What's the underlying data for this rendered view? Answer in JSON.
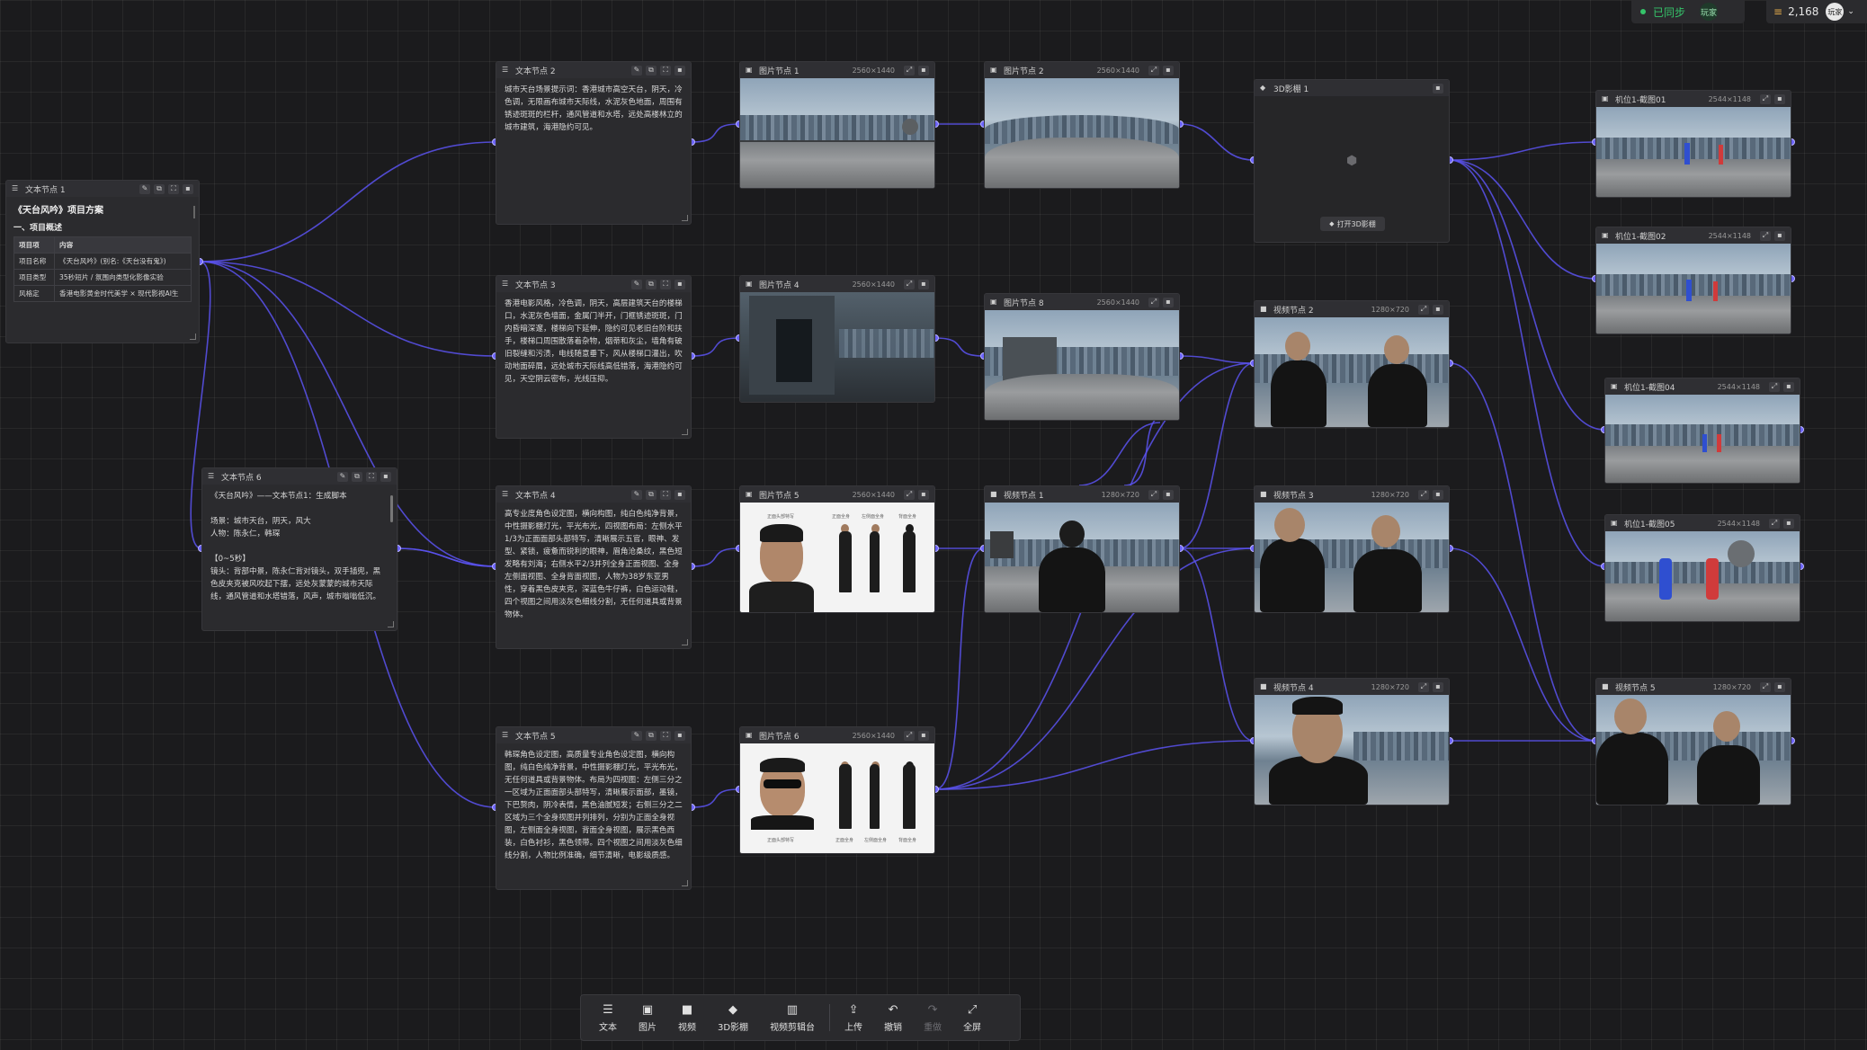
{
  "status": {
    "synced_label": "已同步",
    "user_tag": "玩家",
    "credits": "2,168",
    "avatar_label": "玩家"
  },
  "toolbar": {
    "text": "文本",
    "image": "图片",
    "video": "视频",
    "studio3d": "3D影棚",
    "video_editor": "视频剪辑台",
    "upload": "上传",
    "undo": "撤销",
    "redo": "重做",
    "fullscreen": "全屏"
  },
  "nodes": {
    "text1": {
      "title": "文本节点 1",
      "heading": "《天台风吟》项目方案",
      "section": "一、项目概述",
      "table_header": [
        "项目项",
        "内容"
      ],
      "rows": [
        [
          "项目名称",
          "《天台风吟》(别名:《天台没有鬼》)"
        ],
        [
          "项目类型",
          "35秒短片 / 氛围向类型化影像实验"
        ],
        [
          "风格定",
          "香港电影黄金时代美学 × 现代影视AI生"
        ]
      ]
    },
    "text2": {
      "title": "文本节点 2",
      "body": "城市天台场景提示词：香港城市高空天台，阴天，冷色调，无限画布城市天际线，水泥灰色地面，周围有锈迹斑斑的栏杆，通风管道和水塔，远处高楼林立的城市建筑，海港隐约可见。"
    },
    "text3": {
      "title": "文本节点 3",
      "body": "香港电影风格，冷色调，阴天，高层建筑天台的楼梯口，水泥灰色墙面，金属门半开，门框锈迹斑斑，门内昏暗深邃，楼梯向下延伸，隐约可见老旧台阶和扶手，楼梯口周围散落着杂物，烟蒂和灰尘，墙角有破旧裂缝和污渍，电线随意垂下，风从楼梯口灌出，吹动地面碎屑，远处城市天际线高低错落，海港隐约可见，天空阴云密布，光线压抑。"
    },
    "text4": {
      "title": "文本节点 4",
      "body": "高专业度角色设定图，横向构图，纯白色纯净背景，中性摄影棚灯光，平光布光，四视图布局：左侧水平1/3为正面面部头部特写，清晰展示五官，眼神、发型、紧锁，疲惫而锐利的眼神，眉角沧桑纹，黑色短发略有刘海；右侧水平2/3并列全身正面视图、全身左侧面视图、全身背面视图，人物为38岁东亚男性，穿着黑色皮夹克，深蓝色牛仔裤，白色运动鞋，四个视图之间用淡灰色细线分割，无任何道具或背景物体。"
    },
    "text5": {
      "title": "文本节点 5",
      "body": "韩琛角色设定图，高质量专业角色设定图，横向构图，纯白色纯净背景，中性摄影棚灯光，平光布光，无任何道具或背景物体。布局为四视图：左侧三分之一区域为正面面部头部特写，清晰展示面部，墨镜，下巴赘肉，阴冷表情，黑色油腻短发；右侧三分之二区域为三个全身视图并列排列，分别为正面全身视图，左侧面全身视图，背面全身视图，展示黑色西装，白色衬衫，黑色领带。四个视图之间用淡灰色细线分割，人物比例准确，细节清晰，电影级质感。"
    },
    "text6": {
      "title": "文本节点 6",
      "body": "《天台风吟》——文本节点1：生成脚本\n\n场景：城市天台，阴天，风大\n人物：陈永仁，韩琛\n\n【0~5秒】\n镜头：背部中景，陈永仁背对镜头，双手插兜，黑色皮夹克被风吹起下摆，远处灰蒙蒙的城市天际线，通风管道和水塔错落，风声，城市嗡嗡低沉。"
    },
    "img1": {
      "title": "图片节点 1",
      "res": "2560×1440"
    },
    "img2": {
      "title": "图片节点 2",
      "res": "2560×1440"
    },
    "img4": {
      "title": "图片节点 4",
      "res": "2560×1440"
    },
    "img8": {
      "title": "图片节点 8",
      "res": "2560×1440"
    },
    "img5": {
      "title": "图片节点 5",
      "res": "2560×1440",
      "labels": [
        "正面头部特写",
        "正面全身",
        "左侧面全身",
        "背面全身"
      ]
    },
    "img6": {
      "title": "图片节点 6",
      "res": "2560×1440",
      "labels": [
        "正面头部特写",
        "正面全身",
        "左侧面全身",
        "背面全身"
      ]
    },
    "studio": {
      "title": "3D影棚 1",
      "open_label": "打开3D影棚"
    },
    "vid1": {
      "title": "视频节点 1",
      "res": "1280×720"
    },
    "vid2": {
      "title": "视频节点 2",
      "res": "1280×720"
    },
    "vid3": {
      "title": "视频节点 3",
      "res": "1280×720"
    },
    "vid4": {
      "title": "视频节点 4",
      "res": "1280×720"
    },
    "vid5": {
      "title": "视频节点 5",
      "res": "1280×720"
    },
    "shot1": {
      "title": "机位1-截图01",
      "res": "2544×1148"
    },
    "shot2": {
      "title": "机位1-截图02",
      "res": "2544×1148"
    },
    "shot4": {
      "title": "机位1-截图04",
      "res": "2544×1148"
    },
    "shot5": {
      "title": "机位1-截图05",
      "res": "2544×1148"
    }
  },
  "colors": {
    "edge": "#5b52f0",
    "port": "#6b63ff",
    "sync_dot": "#35c46a",
    "credit_icon": "#e0a84a"
  }
}
